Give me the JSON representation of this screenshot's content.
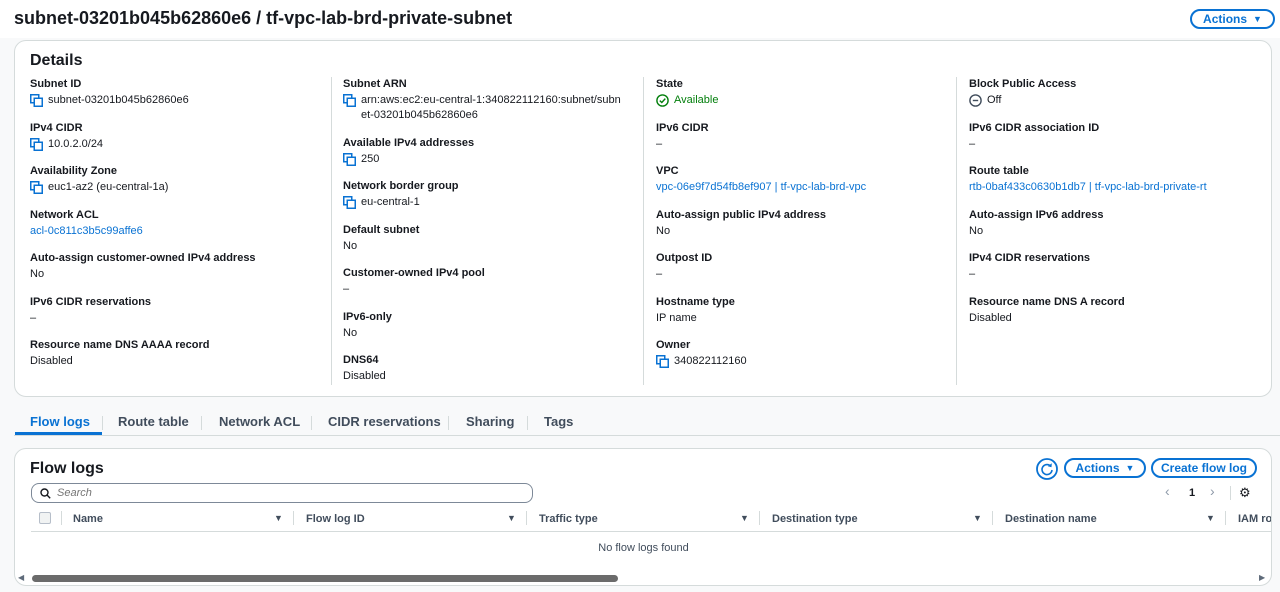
{
  "page": {
    "title": "subnet-03201b045b62860e6 / tf-vpc-lab-brd-private-subnet",
    "actions_label": "Actions"
  },
  "details": {
    "title": "Details",
    "col1": [
      {
        "label": "Subnet ID",
        "value": "subnet-03201b045b62860e6",
        "copy": true
      },
      {
        "label": "IPv4 CIDR",
        "value": "10.0.2.0/24",
        "copy": true
      },
      {
        "label": "Availability Zone",
        "value": "euc1-az2 (eu-central-1a)",
        "copy": true
      },
      {
        "label": "Network ACL",
        "value": "acl-0c811c3b5c99affe6",
        "link": true
      },
      {
        "label": "Auto-assign customer-owned IPv4 address",
        "value": "No"
      },
      {
        "label": "IPv6 CIDR reservations",
        "value": "–"
      },
      {
        "label": "Resource name DNS AAAA record",
        "value": "Disabled"
      }
    ],
    "col2": [
      {
        "label": "Subnet ARN",
        "value": "arn:aws:ec2:eu-central-1:340822112160:subnet/subnet-03201b045b62860e6",
        "copy": true
      },
      {
        "label": "Available IPv4 addresses",
        "value": "250",
        "copy": true
      },
      {
        "label": "Network border group",
        "value": "eu-central-1",
        "copy": true
      },
      {
        "label": "Default subnet",
        "value": "No"
      },
      {
        "label": "Customer-owned IPv4 pool",
        "value": "–"
      },
      {
        "label": "IPv6-only",
        "value": "No"
      },
      {
        "label": "DNS64",
        "value": "Disabled"
      }
    ],
    "col3": [
      {
        "label": "State",
        "value": "Available",
        "status": true
      },
      {
        "label": "IPv6 CIDR",
        "value": "–"
      },
      {
        "label": "VPC",
        "value": "vpc-06e9f7d54fb8ef907 | tf-vpc-lab-brd-vpc",
        "link": true
      },
      {
        "label": "Auto-assign public IPv4 address",
        "value": "No"
      },
      {
        "label": "Outpost ID",
        "value": "–"
      },
      {
        "label": "Hostname type",
        "value": "IP name"
      },
      {
        "label": "Owner",
        "value": "340822112160",
        "copy": true
      }
    ],
    "col4": [
      {
        "label": "Block Public Access",
        "value": "Off",
        "off": true
      },
      {
        "label": "IPv6 CIDR association ID",
        "value": "–"
      },
      {
        "label": "Route table",
        "value": "rtb-0baf433c0630b1db7 | tf-vpc-lab-brd-private-rt",
        "link": true
      },
      {
        "label": "Auto-assign IPv6 address",
        "value": "No"
      },
      {
        "label": "IPv4 CIDR reservations",
        "value": "–"
      },
      {
        "label": "Resource name DNS A record",
        "value": "Disabled"
      }
    ]
  },
  "tabs": [
    "Flow logs",
    "Route table",
    "Network ACL",
    "CIDR reservations",
    "Sharing",
    "Tags"
  ],
  "flow_logs": {
    "title": "Flow logs",
    "actions_label": "Actions",
    "create_label": "Create flow log",
    "search_placeholder": "Search",
    "page_number": "1",
    "columns": [
      "Name",
      "Flow log ID",
      "Traffic type",
      "Destination type",
      "Destination name",
      "IAM ro"
    ],
    "empty_text": "No flow logs found"
  },
  "colors": {
    "accent": "#0972d3",
    "success": "#037f0c",
    "border": "#d5dbdb"
  }
}
